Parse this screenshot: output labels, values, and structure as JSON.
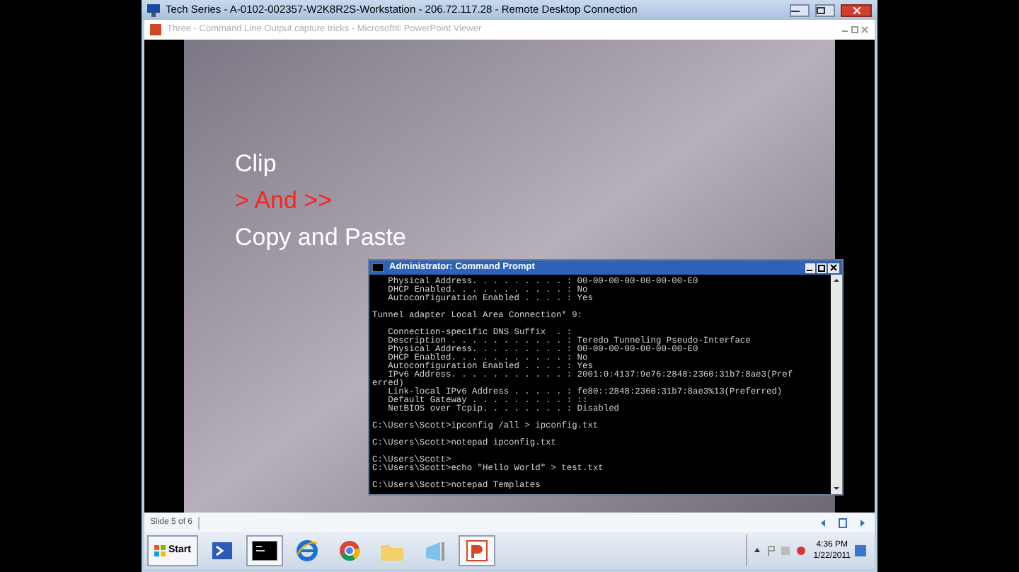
{
  "window": {
    "title": "Tech Series - A-0102-002357-W2K8R2S-Workstation - 206.72.117.28 - Remote Desktop Connection"
  },
  "viewer": {
    "title": "Three - Command Line Output capture tricks - Microsoft® PowerPoint Viewer"
  },
  "slide": {
    "lines": [
      {
        "text": "Clip",
        "color": "#ffffff"
      },
      {
        "text": "> And >>",
        "color": "#ff2020"
      },
      {
        "text": "Copy and Paste",
        "color": "#ffffff"
      }
    ]
  },
  "console": {
    "title": "Administrator: Command Prompt",
    "lines": [
      {
        "text": "   Physical Address. . . . . . . . . : 00-00-00-00-00-00-00-E0",
        "blank_before": false
      },
      {
        "text": "   DHCP Enabled. . . . . . . . . . . : No",
        "blank_before": false
      },
      {
        "text": "   Autoconfiguration Enabled . . . . : Yes",
        "blank_before": false
      },
      {
        "text": "Tunnel adapter Local Area Connection* 9:",
        "blank_before": true
      },
      {
        "text": "   Connection-specific DNS Suffix  . :",
        "blank_before": true
      },
      {
        "text": "   Description . . . . . . . . . . . : Teredo Tunneling Pseudo-Interface",
        "blank_before": false
      },
      {
        "text": "   Physical Address. . . . . . . . . : 00-00-00-00-00-00-00-E0",
        "blank_before": false
      },
      {
        "text": "   DHCP Enabled. . . . . . . . . . . : No",
        "blank_before": false
      },
      {
        "text": "   Autoconfiguration Enabled . . . . : Yes",
        "blank_before": false
      },
      {
        "text": "   IPv6 Address. . . . . . . . . . . : 2001:0:4137:9e76:2848:2360:31b7:8ae3(Pref",
        "blank_before": false
      },
      {
        "text": "erred)",
        "blank_before": false
      },
      {
        "text": "   Link-local IPv6 Address . . . . . : fe80::2848:2360:31b7:8ae3%13(Preferred)",
        "blank_before": false
      },
      {
        "text": "   Default Gateway . . . . . . . . . : ::",
        "blank_before": false
      },
      {
        "text": "   NetBIOS over Tcpip. . . . . . . . : Disabled",
        "blank_before": false
      },
      {
        "text": "C:\\Users\\Scott>ipconfig /all > ipconfig.txt",
        "blank_before": true
      },
      {
        "text": "C:\\Users\\Scott>notepad ipconfig.txt",
        "blank_before": true
      },
      {
        "text": "C:\\Users\\Scott>",
        "blank_before": true
      },
      {
        "text": "C:\\Users\\Scott>echo \"Hello World\" > test.txt",
        "blank_before": false
      },
      {
        "text": "C:\\Users\\Scott>notepad Templates",
        "blank_before": true
      }
    ]
  },
  "status_bar": {
    "slide": "Slide 5 of 6"
  },
  "taskbar": {
    "start": "Start",
    "apps": [
      {
        "kind": "powershell",
        "selected": false
      },
      {
        "kind": "cmd",
        "selected": true
      },
      {
        "kind": "ie",
        "selected": false
      },
      {
        "kind": "chrome",
        "selected": false
      },
      {
        "kind": "folder",
        "selected": false
      },
      {
        "kind": "window",
        "selected": false
      },
      {
        "kind": "ppt",
        "selected": true
      }
    ],
    "time": "4:36 PM",
    "date": "1/22/2011"
  }
}
